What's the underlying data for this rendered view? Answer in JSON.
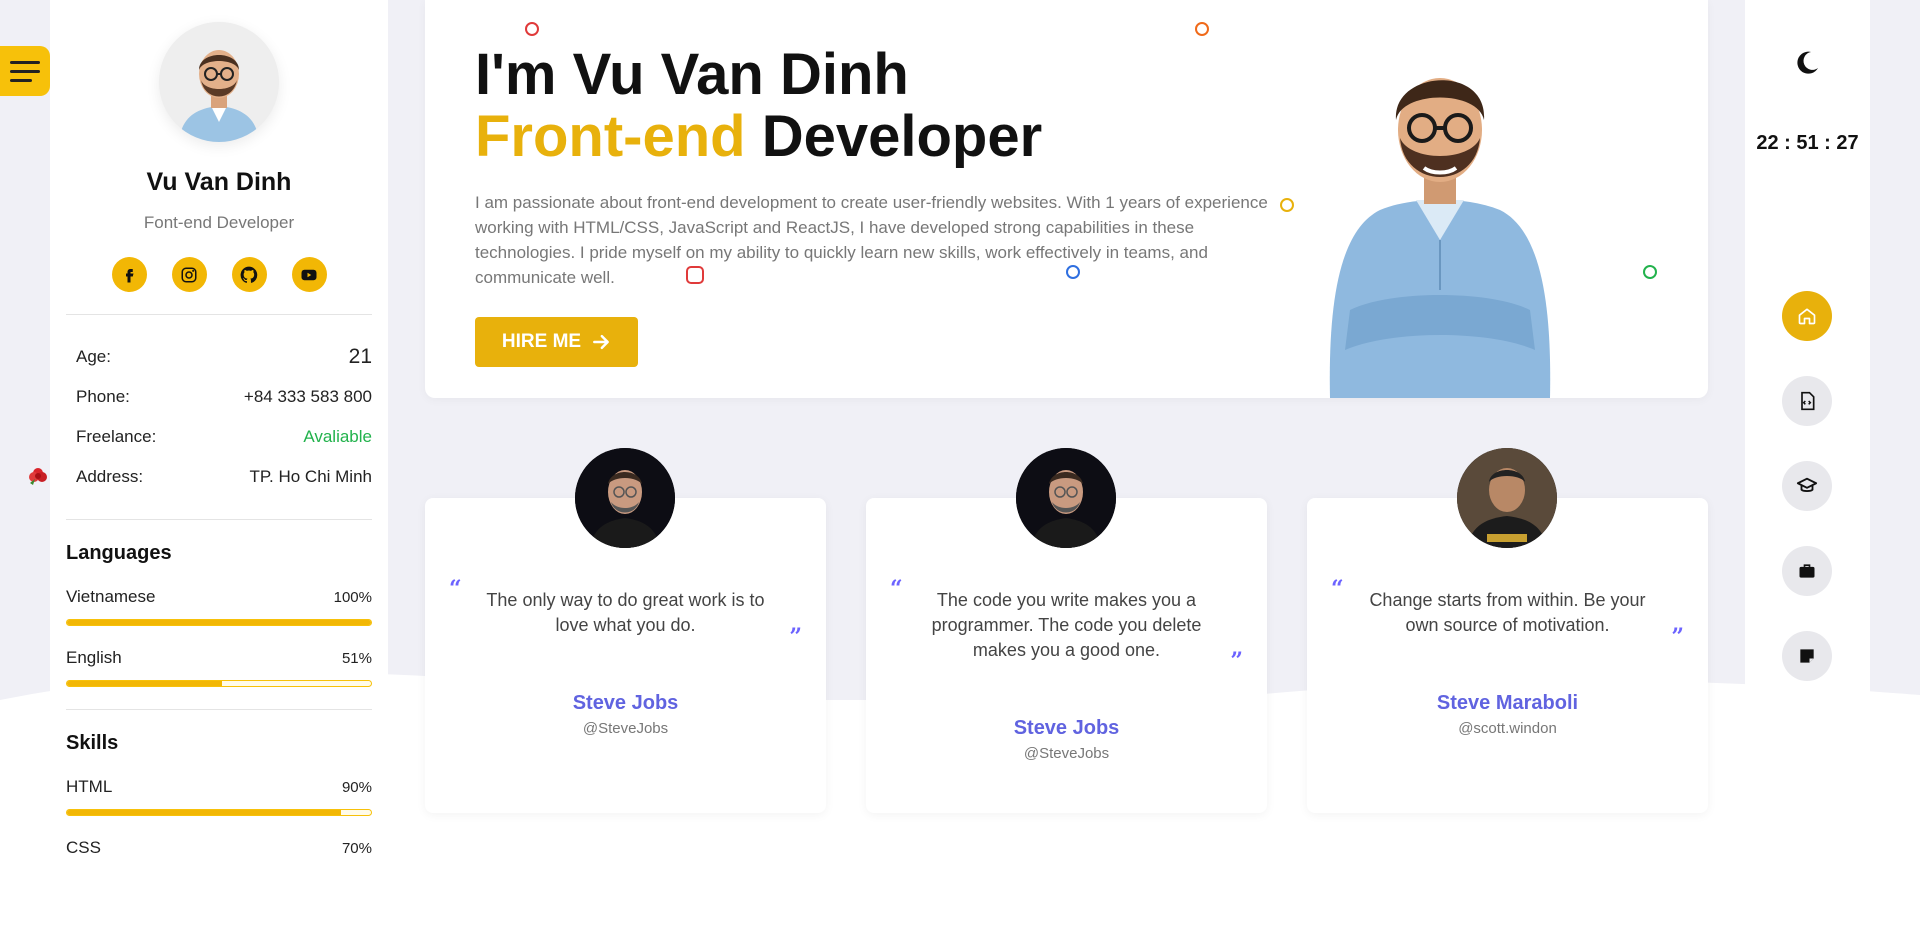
{
  "sidebar": {
    "name": "Vu Van Dinh",
    "role": "Font-end Developer",
    "socials": [
      "facebook-icon",
      "instagram-icon",
      "github-icon",
      "youtube-icon"
    ],
    "info": [
      {
        "label": "Age:",
        "value": "21"
      },
      {
        "label": "Phone:",
        "value": "+84 333 583 800"
      },
      {
        "label": "Freelance:",
        "value": "Avaliable"
      },
      {
        "label": "Address:",
        "value": "TP. Ho Chi Minh"
      }
    ],
    "languages_title": "Languages",
    "languages": [
      {
        "name": "Vietnamese",
        "pct_label": "100%",
        "pct": 100
      },
      {
        "name": "English",
        "pct_label": "51%",
        "pct": 51
      }
    ],
    "skills_title": "Skills",
    "skills": [
      {
        "name": "HTML",
        "pct_label": "90%",
        "pct": 90
      },
      {
        "name": "CSS",
        "pct_label": "70%",
        "pct": 70
      }
    ]
  },
  "hero": {
    "title_line1": "I'm Vu Van Dinh",
    "title_accent": "Front-end",
    "title_rest": " Developer",
    "description": "I am passionate about front-end development to create user-friendly websites. With 1 years of experience working with HTML/CSS, JavaScript and ReactJS, I have developed strong capabilities in these technologies. I pride myself on my ability to quickly learn new skills, work effectively in teams, and communicate well.",
    "hire_label": "HIRE ME",
    "accent_color": "#e8b10c"
  },
  "quotes": [
    {
      "text": "The only way to do great work is to love what you do.",
      "author": "Steve Jobs",
      "handle": "@SteveJobs"
    },
    {
      "text": "The code you write makes you a programmer. The code you delete makes you a good one.",
      "author": "Steve Jobs",
      "handle": "@SteveJobs"
    },
    {
      "text": "Change starts from within. Be your own source of motivation.",
      "author": "Steve Maraboli",
      "handle": "@scott.windon"
    }
  ],
  "quote_open": "“",
  "quote_close": "”",
  "rail": {
    "clock": "22 : 51 : 27",
    "nav_icons": [
      "home-icon",
      "code-file-icon",
      "graduation-icon",
      "briefcase-icon",
      "note-icon"
    ],
    "active_index": 0
  }
}
